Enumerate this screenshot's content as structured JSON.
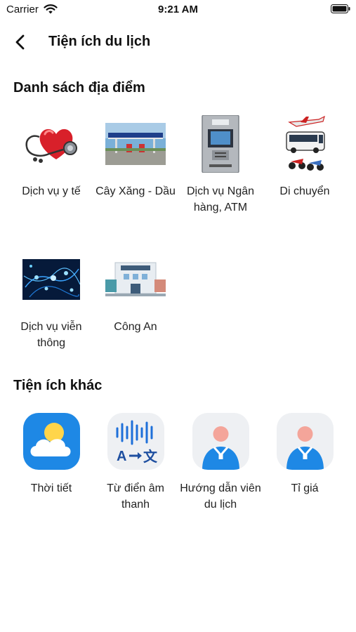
{
  "status_bar": {
    "carrier": "Carrier",
    "time": "9:21 AM"
  },
  "header": {
    "title": "Tiện ích du lịch",
    "back_icon": "chevron-left-icon"
  },
  "places": {
    "title": "Danh sách địa điểm",
    "items": [
      {
        "label": "Dịch vụ y tế",
        "icon": "medical-heart-stethoscope-icon"
      },
      {
        "label": "Cây Xăng - Dầu",
        "icon": "gas-station-icon"
      },
      {
        "label": "Dịch vụ Ngân hàng, ATM",
        "icon": "atm-machine-icon"
      },
      {
        "label": "Di chuyển",
        "icon": "transport-plane-bus-icon"
      },
      {
        "label": "Dịch vụ viễn thông",
        "icon": "telecom-network-icon"
      },
      {
        "label": "Công An",
        "icon": "police-station-icon"
      }
    ]
  },
  "utilities": {
    "title": "Tiện ích khác",
    "items": [
      {
        "label": "Thời tiết",
        "icon": "weather-sun-cloud-icon"
      },
      {
        "label": "Từ điển âm thanh",
        "icon": "audio-translate-icon"
      },
      {
        "label": "Hướng dẫn viên du lịch",
        "icon": "tour-guide-person-icon"
      },
      {
        "label": "Tỉ giá",
        "icon": "exchange-rate-person-icon"
      }
    ]
  },
  "colors": {
    "accent_blue": "#1e88e5",
    "icon_bg": "#eef0f3",
    "skin": "#f4a59a"
  }
}
